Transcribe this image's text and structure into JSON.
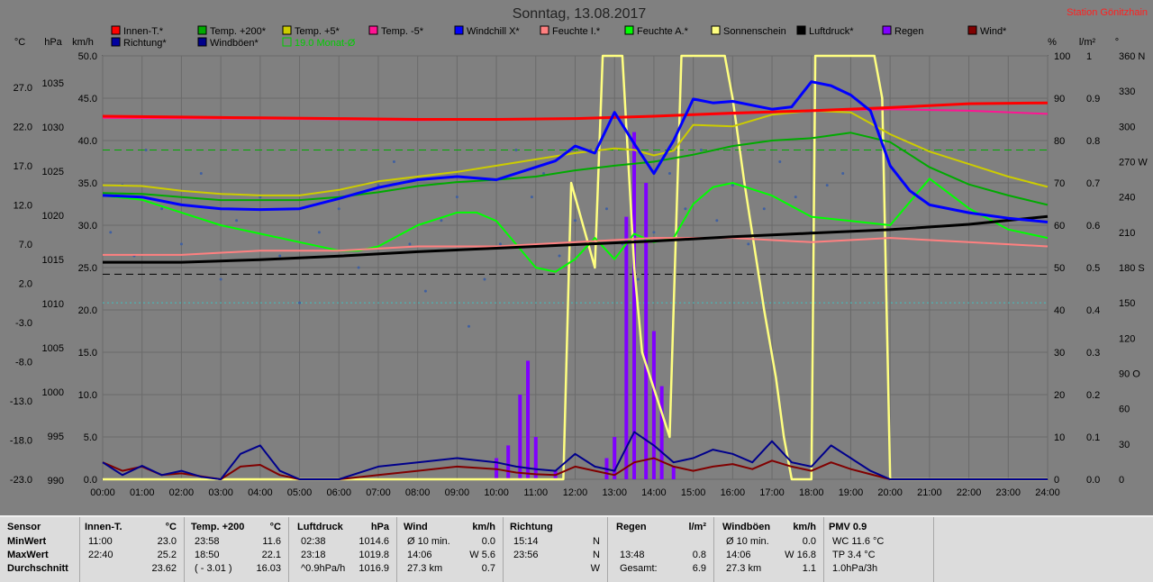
{
  "chart_data": {
    "type": "line",
    "title": "Sonntag, 13.08.2017",
    "station": "Station Gönitzhain",
    "x_ticks": [
      "00:00",
      "01:00",
      "02:00",
      "03:00",
      "04:00",
      "05:00",
      "06:00",
      "07:00",
      "08:00",
      "09:00",
      "10:00",
      "11:00",
      "12:00",
      "13:00",
      "14:00",
      "15:00",
      "16:00",
      "17:00",
      "18:00",
      "19:00",
      "20:00",
      "21:00",
      "22:00",
      "23:00",
      "24:00"
    ],
    "axes": {
      "temp_c": {
        "unit": "°C",
        "ticks": [
          "27.0",
          "22.0",
          "17.0",
          "12.0",
          "7.0",
          "2.0",
          "-3.0",
          "-8.0",
          "-13.0",
          "-18.0",
          "-23.0"
        ],
        "ylim": [
          -23,
          31
        ]
      },
      "pressure_hpa": {
        "unit": "hPa",
        "ticks": [
          "1035",
          "1030",
          "1025",
          "1020",
          "1015",
          "1010",
          "1005",
          "1000",
          "995",
          "990"
        ],
        "ylim": [
          990,
          1038
        ]
      },
      "wind_kmh": {
        "unit": "km/h",
        "ticks": [
          "50.0",
          "45.0",
          "40.0",
          "35.0",
          "30.0",
          "25.0",
          "20.0",
          "15.0",
          "10.0",
          "5.0",
          "0.0"
        ],
        "ylim": [
          0,
          50
        ]
      },
      "humidity_pct": {
        "unit": "%",
        "ticks": [
          "100",
          "90",
          "80",
          "70",
          "60",
          "50",
          "40",
          "30",
          "20",
          "10",
          "0"
        ],
        "ylim": [
          0,
          100
        ]
      },
      "rain_lm2": {
        "unit": "l/m²",
        "ticks": [
          "1",
          "0.9",
          "0.8",
          "0.7",
          "0.6",
          "0.5",
          "0.4",
          "0.3",
          "0.2",
          "0.1",
          "0.0"
        ],
        "ylim": [
          0,
          1
        ]
      },
      "direction_deg": {
        "unit": "°",
        "ticks": [
          "360 N",
          "330",
          "300",
          "270 W",
          "240",
          "210",
          "180 S",
          "150",
          "120",
          "90 O",
          "60",
          "30",
          "0"
        ],
        "ylim": [
          0,
          360
        ]
      }
    },
    "legend": [
      {
        "name": "Innen-T.*",
        "color": "#ff0000"
      },
      {
        "name": "Temp. +200*",
        "color": "#00aa00"
      },
      {
        "name": "Temp. +5*",
        "color": "#cccc00"
      },
      {
        "name": "Temp. -5*",
        "color": "#ff1493"
      },
      {
        "name": "Windchill X*",
        "color": "#0000ff"
      },
      {
        "name": "Feuchte I.*",
        "color": "#ff8080"
      },
      {
        "name": "Feuchte A.*",
        "color": "#00ff00"
      },
      {
        "name": "Sonnenschein",
        "color": "#ffff80"
      },
      {
        "name": "Luftdruck*",
        "color": "#000000"
      },
      {
        "name": "Regen",
        "color": "#8000ff"
      },
      {
        "name": "Wind*",
        "color": "#800000"
      },
      {
        "name": "Richtung*",
        "color": "#0000a0"
      },
      {
        "name": "Windböen*",
        "color": "#00008b"
      },
      {
        "name": "19.0 Monat-Ø",
        "color": "#00cc00"
      }
    ],
    "series": [
      {
        "name": "Innen-T.*",
        "axis": "temp_c",
        "color": "#ff0000",
        "x": [
          0,
          2,
          4,
          6,
          8,
          10,
          12,
          14,
          16,
          18,
          20,
          22,
          24
        ],
        "values": [
          23.3,
          23.2,
          23.1,
          23.0,
          22.9,
          22.9,
          23.0,
          23.3,
          23.7,
          24.0,
          24.4,
          24.9,
          25.0
        ]
      },
      {
        "name": "Temp. -5*",
        "axis": "temp_c",
        "color": "#ff1493",
        "x": [
          0,
          4,
          8,
          12,
          16,
          18,
          20,
          22,
          24
        ],
        "values": [
          23.1,
          23.0,
          22.8,
          23.0,
          23.6,
          24.0,
          24.2,
          24.0,
          23.6
        ]
      },
      {
        "name": "Temp. +5*",
        "axis": "temp_c",
        "color": "#cccc00",
        "x": [
          0,
          1,
          2,
          3,
          4,
          5,
          6,
          7,
          8,
          9,
          10,
          11,
          12,
          13,
          13.5,
          14,
          14.5,
          15,
          16,
          17,
          18,
          19,
          20,
          21,
          22,
          23,
          24
        ],
        "values": [
          14.5,
          14.4,
          13.8,
          13.4,
          13.2,
          13.2,
          13.9,
          15.0,
          15.6,
          16.2,
          17.0,
          17.8,
          18.6,
          19.2,
          19.0,
          18.3,
          18.9,
          22.2,
          22.0,
          23.5,
          24.0,
          23.8,
          21.0,
          18.8,
          17.2,
          15.6,
          14.3
        ]
      },
      {
        "name": "Temp. +200*",
        "axis": "temp_c",
        "color": "#00aa00",
        "x": [
          0,
          1,
          2,
          3,
          4,
          5,
          6,
          7,
          8,
          9,
          10,
          11,
          12,
          13,
          14,
          15,
          16,
          17,
          18,
          19,
          20,
          21,
          22,
          23,
          24
        ],
        "values": [
          13.5,
          13.4,
          13.0,
          12.6,
          12.6,
          12.6,
          13.0,
          13.6,
          14.4,
          14.9,
          15.2,
          15.6,
          16.4,
          17.0,
          17.5,
          18.4,
          19.5,
          20.2,
          20.5,
          21.2,
          20.0,
          16.8,
          14.6,
          13.2,
          12.0
        ]
      },
      {
        "name": "Windchill X*",
        "axis": "temp_c",
        "color": "#0000ff",
        "x": [
          0,
          1,
          2,
          3,
          4,
          5,
          6,
          7,
          8,
          9,
          10,
          11,
          11.5,
          12,
          12.5,
          13,
          13.5,
          14,
          14.5,
          15,
          15.5,
          16,
          17,
          17.5,
          18,
          18.5,
          19,
          19.5,
          20,
          20.5,
          21,
          22,
          23,
          24
        ],
        "values": [
          13.2,
          13.0,
          12.0,
          11.5,
          11.4,
          11.5,
          12.8,
          14.2,
          15.2,
          15.6,
          15.2,
          16.8,
          17.6,
          19.5,
          18.6,
          23.8,
          19.8,
          16.0,
          20.2,
          25.5,
          25.0,
          25.2,
          24.2,
          24.5,
          27.7,
          27.2,
          26.0,
          24.0,
          17.0,
          13.8,
          12.0,
          11.0,
          10.3,
          9.8
        ]
      },
      {
        "name": "Feuchte A.*",
        "axis": "humidity_pct",
        "color": "#00ff00",
        "x": [
          0,
          1,
          2,
          3,
          4,
          5,
          6,
          6.5,
          7,
          8,
          9,
          9.5,
          10,
          11,
          11.5,
          12,
          12.5,
          13,
          13.5,
          14,
          14.5,
          15,
          15.5,
          16,
          17,
          18,
          19,
          20,
          21,
          22,
          23,
          24
        ],
        "values": [
          67,
          66,
          63,
          60,
          58,
          56,
          54,
          54,
          55,
          60,
          63,
          63,
          61,
          50,
          49,
          52,
          57,
          52,
          58,
          56,
          57,
          65,
          69,
          70,
          67,
          62,
          61,
          60,
          71,
          64,
          59,
          57
        ]
      },
      {
        "name": "Feuchte I.*",
        "axis": "humidity_pct",
        "color": "#ff8080",
        "x": [
          0,
          2,
          4,
          6,
          8,
          10,
          12,
          14,
          16,
          18,
          20,
          22,
          24
        ],
        "values": [
          53,
          53,
          54,
          54,
          55,
          55,
          56,
          57,
          57,
          56,
          57,
          56,
          55
        ]
      },
      {
        "name": "Luftdruck*",
        "axis": "pressure_hpa",
        "color": "#000000",
        "x": [
          0,
          2,
          4,
          6,
          8,
          10,
          12,
          14,
          16,
          18,
          20,
          22,
          24
        ],
        "values": [
          1014.6,
          1014.6,
          1014.9,
          1015.3,
          1015.8,
          1016.2,
          1016.6,
          1017.0,
          1017.5,
          1017.9,
          1018.3,
          1018.9,
          1019.8
        ]
      },
      {
        "name": "Wind*",
        "axis": "wind_kmh",
        "color": "#800000",
        "x": [
          0,
          0.5,
          1,
          1.5,
          2,
          3,
          3.5,
          4,
          4.5,
          5,
          6,
          7,
          8,
          9,
          10,
          10.5,
          11,
          11.5,
          12,
          12.5,
          13,
          13.5,
          14,
          14.5,
          15,
          15.5,
          16,
          16.5,
          17,
          17.5,
          18,
          18.5,
          19,
          19.5,
          20,
          24
        ],
        "values": [
          2,
          1,
          1.5,
          0.5,
          0.7,
          0,
          1.5,
          1.7,
          0.5,
          0,
          0,
          0.5,
          1,
          1.5,
          1.2,
          0.8,
          0.6,
          0.5,
          1.5,
          1,
          0.5,
          2,
          2.5,
          1.5,
          1,
          1.5,
          1.8,
          1.2,
          2.2,
          1.5,
          1,
          2,
          1.2,
          0.6,
          0,
          0
        ]
      },
      {
        "name": "Windböen*",
        "axis": "wind_kmh",
        "color": "#00008b",
        "x": [
          0,
          0.5,
          1,
          1.5,
          2,
          2.5,
          3,
          3.5,
          4,
          4.5,
          5,
          6,
          7,
          8,
          9,
          10,
          10.5,
          11,
          11.5,
          12,
          12.5,
          13,
          13.5,
          14,
          14.5,
          15,
          15.5,
          16,
          16.5,
          17,
          17.5,
          18,
          18.5,
          19,
          19.5,
          20,
          24
        ],
        "values": [
          2,
          0.5,
          1.6,
          0.5,
          1,
          0.3,
          0,
          3,
          4,
          1,
          0,
          0,
          1.5,
          2,
          2.5,
          2,
          1.5,
          1.2,
          1,
          3,
          1.5,
          1,
          5.6,
          4,
          2,
          2.5,
          3.5,
          3,
          2,
          4.5,
          2,
          1.5,
          4,
          2.5,
          1,
          0,
          0
        ]
      },
      {
        "name": "Regen",
        "axis": "rain_lm2",
        "color": "#8000ff",
        "x": [
          10,
          10.3,
          10.6,
          10.8,
          11,
          11.5,
          12,
          12.8,
          13,
          13.3,
          13.5,
          13.8,
          14.0,
          14.2,
          14.5
        ],
        "values": [
          0.05,
          0.08,
          0.2,
          0.28,
          0.1,
          0.02,
          0,
          0.05,
          0.1,
          0.62,
          0.82,
          0.7,
          0.35,
          0.22,
          0.03
        ]
      },
      {
        "name": "Sonnenschein",
        "axis": "wind_kmh",
        "color": "#ffff80",
        "x": [
          0,
          11.7,
          11.9,
          12.5,
          12.7,
          13.2,
          13.5,
          13.7,
          14.4,
          14.7,
          15.0,
          15.3,
          15.8,
          16.0,
          16.3,
          16.8,
          17.1,
          17.3,
          17.5,
          18,
          18.1,
          18.4,
          19.6,
          19.8,
          20,
          24
        ],
        "values": [
          0,
          0,
          35,
          25,
          50,
          50,
          25,
          15,
          5,
          50,
          50,
          50,
          50,
          45,
          35,
          20,
          12,
          5,
          0,
          0,
          50,
          50,
          50,
          45,
          0,
          0
        ]
      },
      {
        "name": "Richtung*",
        "axis": "direction_deg",
        "color": "#4060a0",
        "type": "scatter",
        "x": [
          0.2,
          0.5,
          0.8,
          1.1,
          1.5,
          2.0,
          2.5,
          3.0,
          3.4,
          4.0,
          4.5,
          5.0,
          5.5,
          6.0,
          6.5,
          7.0,
          7.4,
          7.8,
          8.2,
          8.6,
          9.0,
          9.3,
          9.7,
          10.1,
          10.5,
          10.9,
          11.2,
          11.6,
          12.0,
          12.4,
          12.8,
          13.2,
          13.6,
          14.0,
          14.4,
          14.8,
          15.2,
          15.6,
          16.0,
          16.4,
          16.8,
          17.2,
          17.6,
          18.0,
          18.4,
          18.8
        ],
        "values": [
          210,
          250,
          190,
          280,
          230,
          200,
          260,
          170,
          220,
          240,
          190,
          150,
          210,
          230,
          180,
          250,
          270,
          200,
          160,
          220,
          240,
          130,
          170,
          200,
          280,
          240,
          260,
          190,
          220,
          280,
          230,
          200,
          170,
          210,
          260,
          230,
          280,
          220,
          250,
          200,
          230,
          270,
          240,
          210,
          250,
          260
        ]
      }
    ],
    "reference_lines": [
      {
        "axis": "temp_c",
        "value": 19.0,
        "color": "#00aa00",
        "style": "dashed"
      },
      {
        "axis": "pressure_hpa",
        "value": 1013.25,
        "color": "#000000",
        "style": "dashed"
      },
      {
        "axis": "temp_c",
        "value": -0.5,
        "color": "#40c0c0",
        "style": "dotted"
      }
    ]
  },
  "stats": {
    "col1": {
      "header": "Sensor",
      "rows": [
        "MinWert",
        "MaxWert",
        "Durchschnitt"
      ]
    },
    "col2": {
      "header": "Innen-T.",
      "unit": "°C",
      "rows": [
        [
          "11:00",
          "23.0"
        ],
        [
          "22:40",
          "25.2"
        ],
        [
          "",
          "23.62"
        ]
      ]
    },
    "col3": {
      "header": "Temp. +200",
      "unit": "°C",
      "rows": [
        [
          "23:58",
          "11.6"
        ],
        [
          "18:50",
          "22.1"
        ],
        [
          "( - 3.01 )",
          "16.03"
        ]
      ]
    },
    "col4": {
      "header": "Luftdruck",
      "unit": "hPa",
      "rows": [
        [
          "02:38",
          "1014.6"
        ],
        [
          "23:18",
          "1019.8"
        ],
        [
          "^0.9hPa/h",
          "1016.9"
        ]
      ]
    },
    "col5": {
      "header": "Wind",
      "unit": "km/h",
      "rows": [
        [
          "Ø 10 min.",
          "0.0"
        ],
        [
          "14:06",
          "W 5.6"
        ],
        [
          "27.3 km",
          "0.7"
        ]
      ]
    },
    "col6": {
      "header": "Richtung",
      "unit": "",
      "rows": [
        [
          "15:14",
          "N"
        ],
        [
          "23:56",
          "N"
        ],
        [
          "",
          "W"
        ]
      ]
    },
    "col7": {
      "header": "Regen",
      "unit": "l/m²",
      "rows": [
        [
          "",
          ""
        ],
        [
          "13:48",
          "0.8"
        ],
        [
          "Gesamt:",
          "6.9"
        ]
      ]
    },
    "col8": {
      "header": "Windböen",
      "unit": "km/h",
      "rows": [
        [
          "Ø 10 min.",
          "0.0"
        ],
        [
          "14:06",
          "W 16.8"
        ],
        [
          "27.3 km",
          "1.1"
        ]
      ]
    },
    "col9": {
      "header": "PMV 0.9",
      "unit": "",
      "rows": [
        [
          "WC 11.6 °C",
          ""
        ],
        [
          "TP 3.4 °C",
          ""
        ],
        [
          "1.0hPa/3h",
          ""
        ]
      ]
    }
  }
}
